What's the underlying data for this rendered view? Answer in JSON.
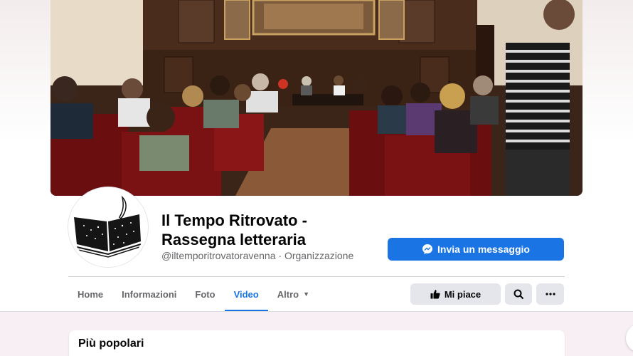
{
  "page": {
    "name": "Il Tempo Ritrovato - Rassegna letteraria",
    "name_line1": "Il Tempo Ritrovato -",
    "name_line2": "Rassegna letteraria",
    "handle": "@iltemporitrovatoravenna",
    "category": "Organizzazione",
    "meta_separator": " · "
  },
  "actions": {
    "message_label": "Invia un messaggio",
    "like_label": "Mi piace"
  },
  "tabs": [
    {
      "label": "Home",
      "active": false
    },
    {
      "label": "Informazioni",
      "active": false
    },
    {
      "label": "Foto",
      "active": false
    },
    {
      "label": "Video",
      "active": true
    },
    {
      "label": "Altro",
      "active": false,
      "dropdown": true
    }
  ],
  "section": {
    "title": "Più popolari"
  },
  "colors": {
    "accent": "#1b74e4",
    "button_bg": "#e4e6eb",
    "secondary_text": "#65676b"
  },
  "icons": {
    "message": "messenger-icon",
    "like": "thumbs-up-icon",
    "search": "search-icon",
    "more": "more-dots-icon",
    "dropdown": "chevron-down-icon"
  }
}
